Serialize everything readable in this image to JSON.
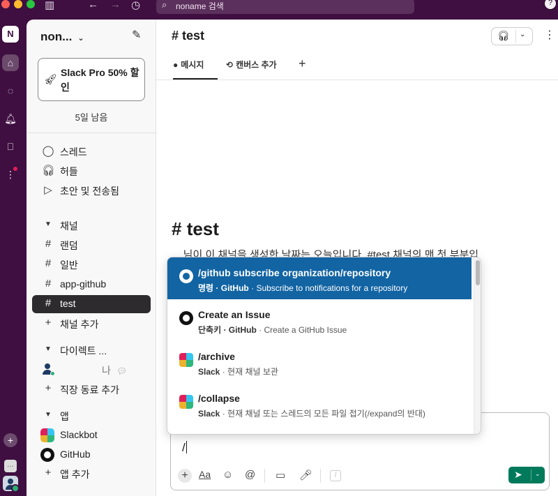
{
  "search": {
    "placeholder": "noname 검색"
  },
  "workspace": {
    "initial": "N",
    "name": "non..."
  },
  "promo": {
    "label": "Slack Pro 50% 할인",
    "days_left": "5일 남음"
  },
  "nav": [
    {
      "label": "스레드",
      "icon": "threads-icon"
    },
    {
      "label": "허들",
      "icon": "headphones-icon"
    },
    {
      "label": "초안 및 전송됨",
      "icon": "send-icon"
    }
  ],
  "channels": {
    "section": "채널",
    "items": [
      "랜덤",
      "일반",
      "app-github",
      "test"
    ],
    "selected": "test",
    "add": "채널 추가"
  },
  "dms": {
    "section": "다이렉트 ...",
    "item_suffix": "나",
    "add": "직장 동료 추가"
  },
  "apps": {
    "section": "앱",
    "items": [
      "Slackbot",
      "GitHub"
    ],
    "add": "앱 추가"
  },
  "channel": {
    "name": "test",
    "tabs": [
      "메시지",
      "캔버스 추가"
    ],
    "intro_title": "test",
    "intro_text": "__님이 이 채널을 생성한 날짜는 오늘입니다. #test 채널의 맨 첫 부분입"
  },
  "composer": {
    "text": "/"
  },
  "suggestions": [
    {
      "command": "/github subscribe organization/repository",
      "type": "명령",
      "source": "GitHub",
      "description": "Subscribe to notifications for a repository",
      "logo": "github",
      "selected": true
    },
    {
      "command": "Create an Issue",
      "type": "단축키",
      "source": "GitHub",
      "description": "Create a GitHub Issue",
      "logo": "github",
      "selected": false
    },
    {
      "command": "/archive",
      "type": "",
      "source": "Slack",
      "description": "현재 채널 보관",
      "logo": "slack",
      "selected": false
    },
    {
      "command": "/collapse",
      "type": "",
      "source": "Slack",
      "description": "현재 채널 또는 스레드의 모든 파일 접기(/expand의 반대)",
      "logo": "slack",
      "selected": false
    }
  ],
  "colors": {
    "aubergine": "#3f0e40",
    "selection": "#1264a3",
    "send": "#007a5a"
  }
}
